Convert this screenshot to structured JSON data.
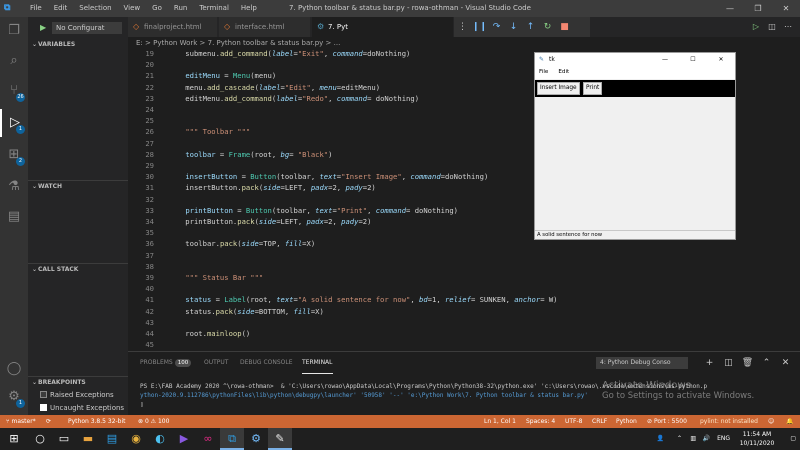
{
  "titlebar": {
    "menu": [
      "File",
      "Edit",
      "Selection",
      "View",
      "Go",
      "Run",
      "Terminal",
      "Help"
    ],
    "title": "7. Python toolbar & status bar.py - rowa-othman - Visual Studio Code"
  },
  "sidebar": {
    "config": "No Configurat",
    "sections": {
      "variables": "VARIABLES",
      "watch": "WATCH",
      "callstack": "CALL STACK",
      "breakpoints": "BREAKPOINTS"
    },
    "breakpoints": [
      {
        "label": "Raised Exceptions",
        "checked": false
      },
      {
        "label": "Uncaught Exceptions",
        "checked": true
      }
    ]
  },
  "tabs": [
    {
      "label": "finalproject.html"
    },
    {
      "label": "interface.html"
    },
    {
      "label": "7. Pyt"
    }
  ],
  "breadcrumb": "E: > Python Work > 7. Python toolbar & status bar.py > ...",
  "editor": {
    "lines": [
      {
        "n": "19",
        "text": "    submenu.add_command(label=\"Exit\", command=doNothing)"
      },
      {
        "n": "20",
        "text": ""
      },
      {
        "n": "21",
        "text": "    editMenu = Menu(menu)"
      },
      {
        "n": "22",
        "text": "    menu.add_cascade(label=\"Edit\", menu=editMenu)"
      },
      {
        "n": "23",
        "text": "    editMenu.add_command(label=\"Redo\", command= doNothing)"
      },
      {
        "n": "24",
        "text": ""
      },
      {
        "n": "25",
        "text": ""
      },
      {
        "n": "26",
        "text": "    \"\"\" Toolbar \"\"\""
      },
      {
        "n": "27",
        "text": ""
      },
      {
        "n": "28",
        "text": "    toolbar = Frame(root, bg= \"Black\")"
      },
      {
        "n": "29",
        "text": ""
      },
      {
        "n": "30",
        "text": "    insertButton = Button(toolbar, text=\"Insert Image\", command=doNothing)"
      },
      {
        "n": "31",
        "text": "    insertButton.pack(side=LEFT, padx=2, pady=2)"
      },
      {
        "n": "32",
        "text": ""
      },
      {
        "n": "33",
        "text": "    printButton = Button(toolbar, text=\"Print\", command= doNothing)"
      },
      {
        "n": "34",
        "text": "    printButton.pack(side=LEFT, padx=2, pady=2)"
      },
      {
        "n": "35",
        "text": ""
      },
      {
        "n": "36",
        "text": "    toolbar.pack(side=TOP, fill=X)"
      },
      {
        "n": "37",
        "text": ""
      },
      {
        "n": "38",
        "text": ""
      },
      {
        "n": "39",
        "text": "    \"\"\" Status Bar \"\"\""
      },
      {
        "n": "40",
        "text": ""
      },
      {
        "n": "41",
        "text": "    status = Label(root, text=\"A solid sentence for now\", bd=1, relief= SUNKEN, anchor= W)"
      },
      {
        "n": "42",
        "text": "    status.pack(side=BOTTOM, fill=X)"
      },
      {
        "n": "43",
        "text": ""
      },
      {
        "n": "44",
        "text": "    root.mainloop()"
      },
      {
        "n": "45",
        "text": ""
      }
    ]
  },
  "tk": {
    "title": "tk",
    "menu": [
      "File",
      "Edit"
    ],
    "insert_label": "Insert Image",
    "print_label": "Print",
    "status": "A solid sentence for now"
  },
  "panel": {
    "tabs": {
      "problems": "PROBLEMS",
      "problems_count": "100",
      "output": "OUTPUT",
      "debug": "DEBUG CONSOLE",
      "terminal": "TERMINAL"
    },
    "terminal_select": "4: Python Debug Conso",
    "terminal_lines": [
      "PS E:\\FAB Academy 2020 ^\\rowa-othman>  & 'C:\\Users\\rowao\\AppData\\Local\\Programs\\Python\\Python38-32\\python.exe' 'c:\\Users\\rowao\\.vscode\\extensions\\ms-python.p",
      "ython-2020.9.112786\\pythonFiles\\lib\\python\\debugpy\\launcher' '50958' '--' 'e:\\Python Work\\7. Python toolbar & status bar.py'"
    ],
    "watermark_1": "Activate Windows",
    "watermark_2": "Go to Settings to activate Windows."
  },
  "statusbar": {
    "branch": "master*",
    "python": "Python 3.8.5 32-bit",
    "errors": "0",
    "warnings": "100",
    "position": "Ln 1, Col 1",
    "spaces": "Spaces: 4",
    "encoding": "UTF-8",
    "eol": "CRLF",
    "language": "Python",
    "port": "Port : 5500",
    "lint": "pylint: not installed"
  },
  "taskbar": {
    "time": "11:54 AM",
    "date": "10/11/2020",
    "lang": "ENG"
  },
  "colors": {
    "statusbar": "#cc6633",
    "activity": "#333333",
    "sidebar": "#252526",
    "editor": "#1e1e1e"
  }
}
